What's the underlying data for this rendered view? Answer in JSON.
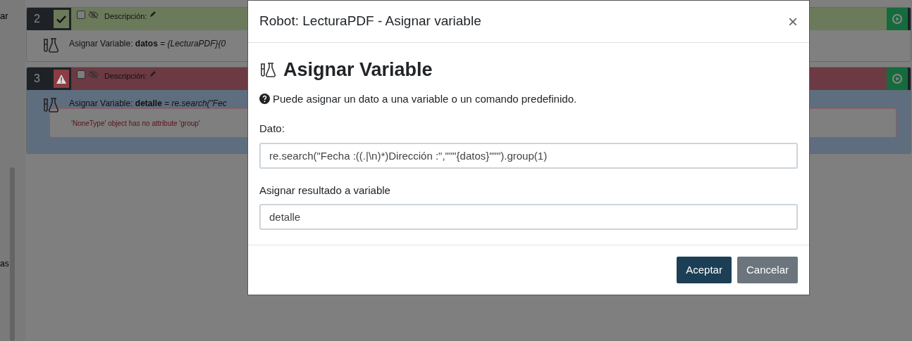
{
  "sidebar": {
    "texts": [
      "ar",
      "as"
    ]
  },
  "steps": [
    {
      "number": "2",
      "kind": "success",
      "checked": false,
      "description_label": "Descripción:",
      "text": "Asignar Variable: **datos** = *{LecturaPDF}{0*"
    },
    {
      "number": "3",
      "kind": "error",
      "checked": false,
      "description_label": "Descripción:",
      "text": "Asignar Variable: **detalle** = *re.search(\"Fec*",
      "error": "'NoneType' object has no attribute 'group'"
    }
  ],
  "modal": {
    "title": "Robot: LecturaPDF - Asignar variable",
    "close": "×",
    "heading": "Asignar Variable",
    "help": "Puede asignar un dato a una variable o un comando predefinido.",
    "fields": [
      {
        "label": "Dato:",
        "value": "re.search(\"Fecha :((.|\\n)*)Dirección :\",\"\"\"{datos}\"\"\").group(1)"
      },
      {
        "label": "Asignar resultado a variable",
        "value": "detalle"
      }
    ],
    "buttons": [
      {
        "label": "Aceptar",
        "kind": "primary"
      },
      {
        "label": "Cancelar",
        "kind": "secondary"
      }
    ]
  }
}
